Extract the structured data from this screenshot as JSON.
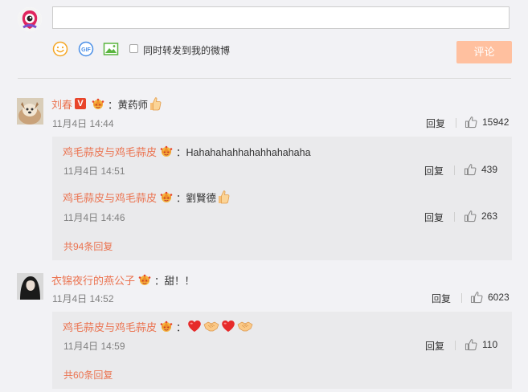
{
  "composer": {
    "repost_label": "同时转发到我的微博",
    "submit_label": "评论",
    "gif_label": "GIF"
  },
  "comments": [
    {
      "user": "刘春",
      "text": "：黄药师",
      "time": "11月4日 14:44",
      "reply": "回复",
      "likes": "15942",
      "subs": [
        {
          "user": "鸡毛蒜皮与鸡毛蒜皮",
          "text": "：Hahahahahhahahhahahaha",
          "time": "11月4日 14:51",
          "reply": "回复",
          "likes": "439"
        },
        {
          "user": "鸡毛蒜皮与鸡毛蒜皮",
          "text": "：劉賢德",
          "time": "11月4日 14:46",
          "reply": "回复",
          "likes": "263"
        }
      ],
      "more": "共94条回复"
    },
    {
      "user": "衣锦夜行的燕公子",
      "text": "：甜！！",
      "time": "11月4日 14:52",
      "reply": "回复",
      "likes": "6023",
      "subs": [
        {
          "user": "鸡毛蒜皮与鸡毛蒜皮",
          "text": "：",
          "time": "11月4日 14:59",
          "reply": "回复",
          "likes": "110"
        }
      ],
      "more": "共60条回复"
    }
  ],
  "colors": {
    "accent": "#eb7350",
    "submit_bg": "#ffc09f",
    "background": "#f2f2f5",
    "subbox": "#eaeaec"
  },
  "icons": [
    "smile-icon",
    "gif-icon",
    "image-icon",
    "thumbs-up-icon",
    "crown-badge-icon",
    "verified-v-icon",
    "heart-icon",
    "handshake-icon"
  ]
}
